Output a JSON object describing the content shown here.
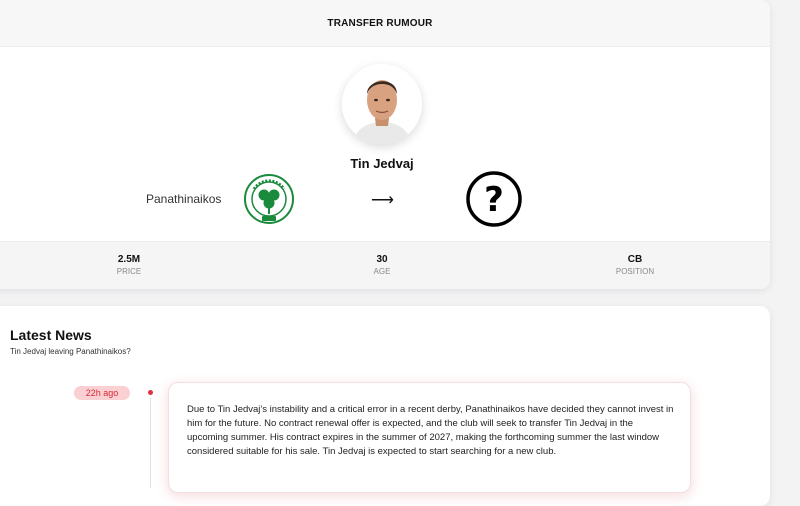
{
  "transfer": {
    "header": "TRANSFER RUMOUR",
    "player_name": "Tin Jedvaj",
    "from_club": "Panathinaikos",
    "to_club_symbol": "?",
    "arrow": "⟶",
    "stats": [
      {
        "value": "2.5M",
        "label": "PRICE"
      },
      {
        "value": "30",
        "label": "AGE"
      },
      {
        "value": "CB",
        "label": "POSITION"
      }
    ],
    "colors": {
      "club_green": "#1a8a3c"
    }
  },
  "news": {
    "title": "Latest News",
    "subtitle": "Tin Jedvaj leaving Panathinaikos?",
    "items": [
      {
        "time": "22h ago",
        "text": "Due to Tin Jedvaj's instability and a critical error in a recent derby, Panathinaikos have decided they cannot invest in him for the future. No contract renewal offer is expected, and the club will seek to transfer Tin Jedvaj in the upcoming summer. His contract expires in the summer of 2027, making the forthcoming summer the last window considered suitable for his sale. Tin Jedvaj is expected to start searching for a new club."
      }
    ],
    "accent": "#d22a3a"
  }
}
